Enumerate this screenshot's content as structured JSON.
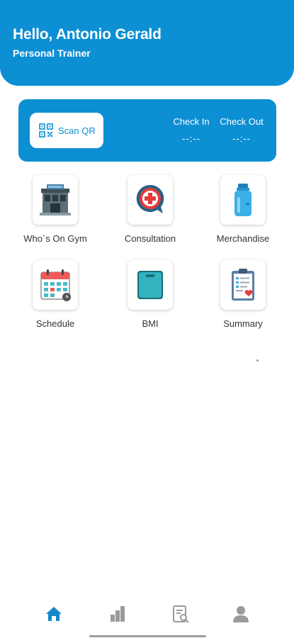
{
  "header": {
    "greeting": "Hello, Antonio Gerald",
    "role": "Personal Trainer"
  },
  "check_card": {
    "scan_label": "Scan QR",
    "check_in_label": "Check In",
    "check_in_time": "--:--",
    "check_out_label": "Check Out",
    "check_out_time": "--:--"
  },
  "menu": [
    {
      "label": "Who`s On Gym",
      "icon": "gym-building-icon"
    },
    {
      "label": "Consultation",
      "icon": "medical-chat-icon"
    },
    {
      "label": "Merchandise",
      "icon": "water-bottle-icon"
    },
    {
      "label": "Schedule",
      "icon": "calendar-icon"
    },
    {
      "label": "BMI",
      "icon": "weight-scale-icon"
    },
    {
      "label": "Summary",
      "icon": "clipboard-icon"
    }
  ],
  "bottom_nav": [
    {
      "icon": "home-icon",
      "active": true
    },
    {
      "icon": "bar-chart-icon",
      "active": false
    },
    {
      "icon": "report-search-icon",
      "active": false
    },
    {
      "icon": "profile-icon",
      "active": false
    }
  ],
  "colors": {
    "primary": "#0d8fd3",
    "nav_active": "#1488c9",
    "nav_inactive": "#9a9a9a",
    "text": "#333333"
  }
}
